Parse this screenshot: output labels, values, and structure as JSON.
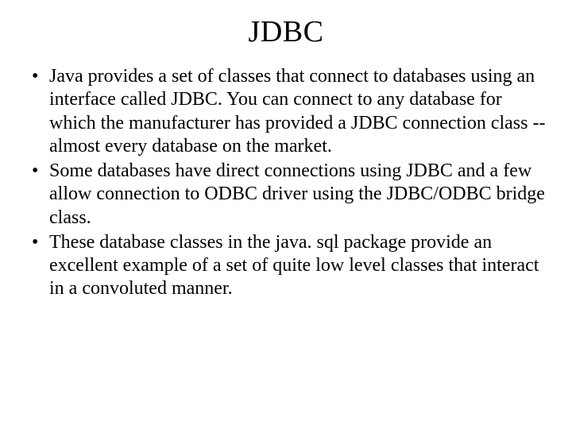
{
  "title": "JDBC",
  "bullets": [
    "Java provides a set of classes that connect to databases using an interface called JDBC. You can connect to any database for which the manufacturer has provided a JDBC connection class -- almost every database on the market.",
    "Some databases have direct connections using JDBC and a few allow connection to ODBC driver using the JDBC/ODBC bridge class.",
    "These database classes in the java. sql package provide an excellent example of a set of quite low level classes that interact in a convoluted manner."
  ]
}
